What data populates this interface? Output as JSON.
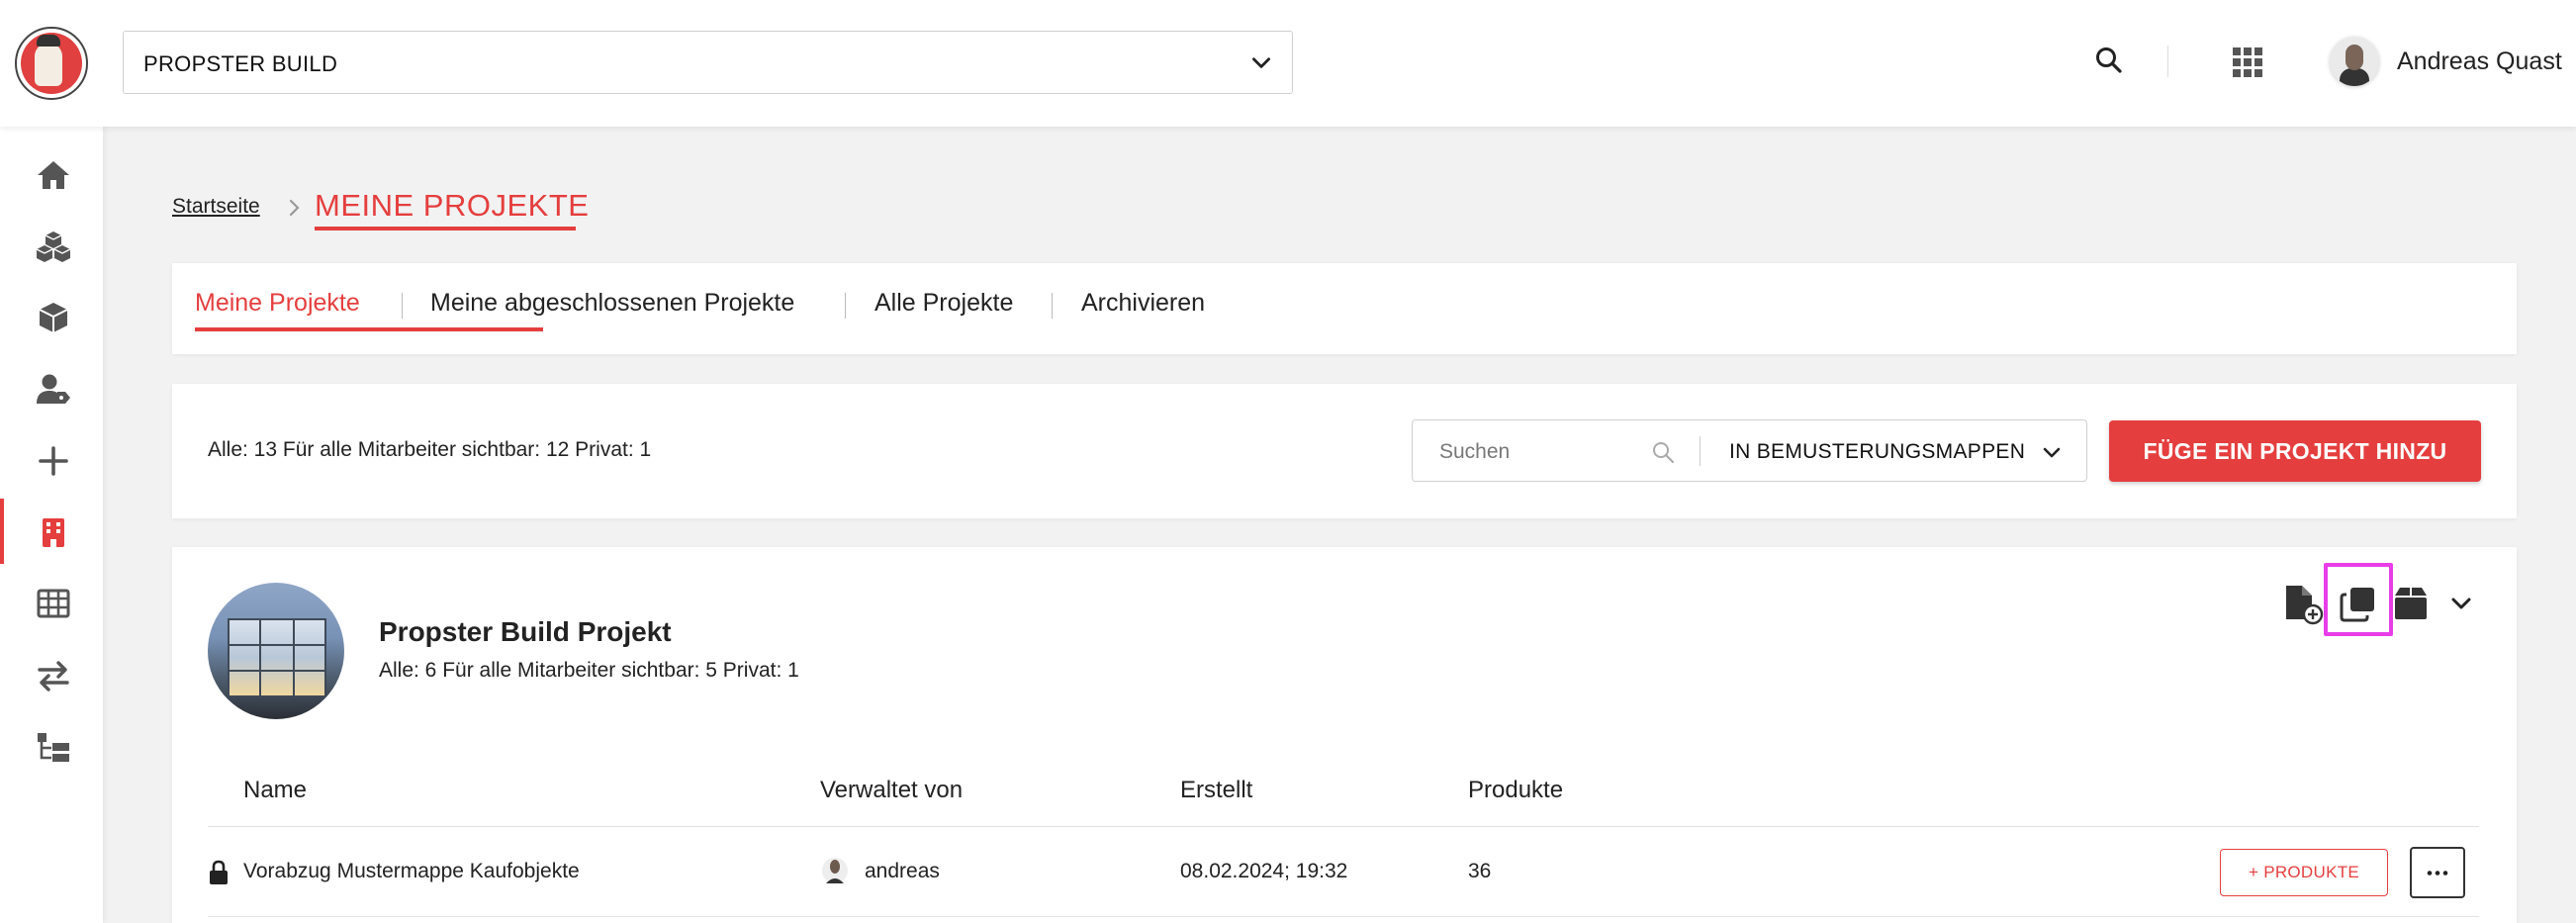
{
  "header": {
    "project_select_value": "PROPSTER BUILD",
    "user_name": "Andreas Quast"
  },
  "breadcrumb": {
    "home": "Startseite",
    "current": "MEINE PROJEKTE"
  },
  "tabs": [
    {
      "label": "Meine Projekte",
      "active": true
    },
    {
      "label": "Meine abgeschlossenen Projekte",
      "active": false
    },
    {
      "label": "Alle Projekte",
      "active": false
    },
    {
      "label": "Archivieren",
      "active": false
    }
  ],
  "filter": {
    "counts": "Alle: 13 Für alle Mitarbeiter sichtbar: 12 Privat: 1",
    "search_placeholder": "Suchen",
    "mode_label": "IN BEMUSTERUNGSMAPPEN",
    "add_button": "FÜGE EIN PROJEKT HINZU"
  },
  "project": {
    "title": "Propster Build Projekt",
    "counts": "Alle: 6 Für alle Mitarbeiter sichtbar: 5 Privat: 1",
    "columns": {
      "name": "Name",
      "manager": "Verwaltet von",
      "created": "Erstellt",
      "products": "Produkte"
    },
    "rows": [
      {
        "name": "Vorabzug Mustermappe Kaufobjekte",
        "manager": "andreas",
        "created": "08.02.2024; 19:32",
        "products": "36",
        "add_products_label": "+ PRODUKTE",
        "private": true
      }
    ]
  },
  "colors": {
    "accent": "#e53e3e",
    "highlight": "#e83ee8"
  },
  "sidebar_icons": [
    "home-icon",
    "cubes-icon",
    "cube-icon",
    "user-tag-icon",
    "plus-icon",
    "building-icon",
    "table-icon",
    "arrows-exchange-icon",
    "tree-structure-icon"
  ]
}
